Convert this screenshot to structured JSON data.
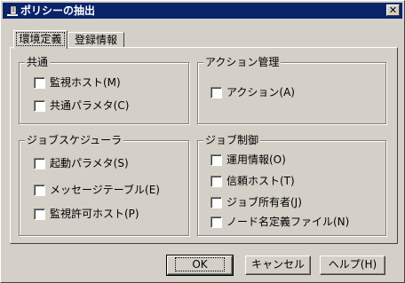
{
  "window": {
    "title": "ポリシーの抽出",
    "close_glyph": "✕"
  },
  "tabs": [
    {
      "label": "環境定義",
      "active": true
    },
    {
      "label": "登録情報",
      "active": false
    }
  ],
  "groups": {
    "common": {
      "label": "共通",
      "items": [
        {
          "label": "監視ホスト(M)",
          "checked": false
        },
        {
          "label": "共通パラメタ(C)",
          "checked": false
        }
      ]
    },
    "action": {
      "label": "アクション管理",
      "items": [
        {
          "label": "アクション(A)",
          "checked": false
        }
      ]
    },
    "scheduler": {
      "label": "ジョブスケジューラ",
      "items": [
        {
          "label": "起動パラメタ(S)",
          "checked": false
        },
        {
          "label": "メッセージテーブル(E)",
          "checked": false
        },
        {
          "label": "監視許可ホスト(P)",
          "checked": false
        }
      ]
    },
    "jobcontrol": {
      "label": "ジョブ制御",
      "items": [
        {
          "label": "運用情報(O)",
          "checked": false
        },
        {
          "label": "信頼ホスト(T)",
          "checked": false
        },
        {
          "label": "ジョブ所有者(J)",
          "checked": false
        },
        {
          "label": "ノード名定義ファイル(N)",
          "checked": false
        }
      ]
    }
  },
  "buttons": {
    "ok": "OK",
    "cancel": "キャンセル",
    "help": "ヘルプ(H)"
  }
}
